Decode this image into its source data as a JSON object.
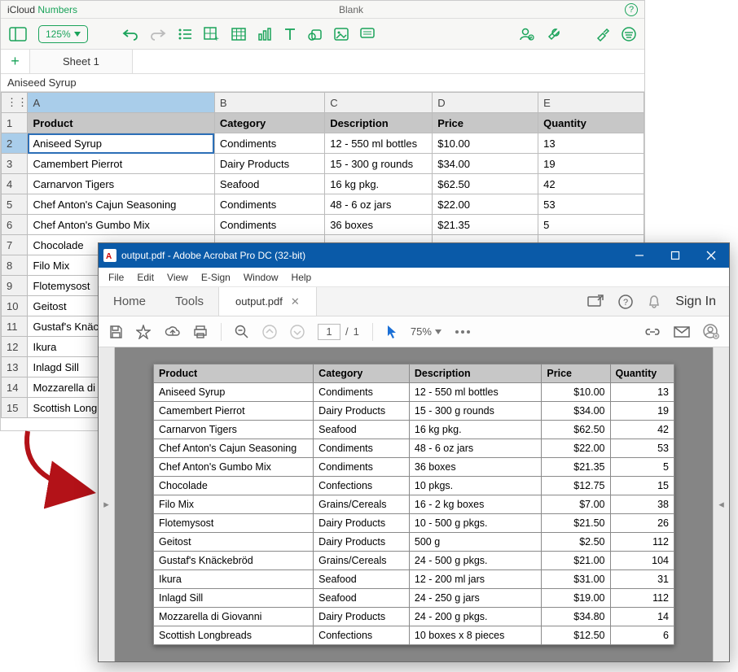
{
  "numbers": {
    "brand_prefix": "iCloud",
    "brand": "Numbers",
    "doc_title": "Blank",
    "zoom": "125%",
    "sheet_tab": "Sheet 1",
    "formula_value": "Aniseed Syrup",
    "columns": [
      "A",
      "B",
      "C",
      "D",
      "E"
    ],
    "headers": [
      "Product",
      "Category",
      "Description",
      "Price",
      "Quantity"
    ],
    "rows": [
      {
        "n": "1",
        "product": "Aniseed Syrup",
        "category": "Condiments",
        "description": "12 - 550 ml bottles",
        "price": "$10.00",
        "quantity": "13"
      },
      {
        "n": "2",
        "product": "Camembert Pierrot",
        "category": "Dairy Products",
        "description": "15 - 300 g rounds",
        "price": "$34.00",
        "quantity": "19"
      },
      {
        "n": "3",
        "product": "Carnarvon Tigers",
        "category": "Seafood",
        "description": "16 kg pkg.",
        "price": "$62.50",
        "quantity": "42"
      },
      {
        "n": "4",
        "product": "Chef Anton's Cajun Seasoning",
        "category": "Condiments",
        "description": "48 - 6 oz jars",
        "price": "$22.00",
        "quantity": "53"
      },
      {
        "n": "5",
        "product": "Chef Anton's Gumbo Mix",
        "category": "Condiments",
        "description": "36 boxes",
        "price": "$21.35",
        "quantity": "5"
      },
      {
        "n": "6",
        "product": "Chocolade",
        "category": "",
        "description": "",
        "price": "",
        "quantity": ""
      },
      {
        "n": "7",
        "product": "Filo Mix",
        "category": "",
        "description": "",
        "price": "",
        "quantity": ""
      },
      {
        "n": "8",
        "product": "Flotemysost",
        "category": "",
        "description": "",
        "price": "",
        "quantity": ""
      },
      {
        "n": "9",
        "product": "Geitost",
        "category": "",
        "description": "",
        "price": "",
        "quantity": ""
      },
      {
        "n": "10",
        "product": "Gustaf's Knäck",
        "category": "",
        "description": "",
        "price": "",
        "quantity": ""
      },
      {
        "n": "11",
        "product": "Ikura",
        "category": "",
        "description": "",
        "price": "",
        "quantity": ""
      },
      {
        "n": "12",
        "product": "Inlagd Sill",
        "category": "",
        "description": "",
        "price": "",
        "quantity": ""
      },
      {
        "n": "13",
        "product": "Mozzarella di G",
        "category": "",
        "description": "",
        "price": "",
        "quantity": ""
      },
      {
        "n": "14",
        "product": "Scottish Longb",
        "category": "",
        "description": "",
        "price": "",
        "quantity": ""
      }
    ]
  },
  "acrobat": {
    "window_title": "output.pdf - Adobe Acrobat Pro DC (32-bit)",
    "menus": [
      "File",
      "Edit",
      "View",
      "E-Sign",
      "Window",
      "Help"
    ],
    "nav_home": "Home",
    "nav_tools": "Tools",
    "doc_tab": "output.pdf",
    "sign_in": "Sign In",
    "page_current": "1",
    "page_sep": "/",
    "page_total": "1",
    "zoom": "75%",
    "headers": [
      "Product",
      "Category",
      "Description",
      "Price",
      "Quantity"
    ],
    "rows": [
      {
        "product": "Aniseed Syrup",
        "category": "Condiments",
        "description": "12 - 550 ml bottles",
        "price": "$10.00",
        "quantity": "13"
      },
      {
        "product": "Camembert Pierrot",
        "category": "Dairy Products",
        "description": "15 - 300 g rounds",
        "price": "$34.00",
        "quantity": "19"
      },
      {
        "product": "Carnarvon Tigers",
        "category": "Seafood",
        "description": "16 kg pkg.",
        "price": "$62.50",
        "quantity": "42"
      },
      {
        "product": "Chef Anton's Cajun Seasoning",
        "category": "Condiments",
        "description": "48 - 6 oz jars",
        "price": "$22.00",
        "quantity": "53"
      },
      {
        "product": "Chef Anton's Gumbo Mix",
        "category": "Condiments",
        "description": "36 boxes",
        "price": "$21.35",
        "quantity": "5"
      },
      {
        "product": "Chocolade",
        "category": "Confections",
        "description": "10 pkgs.",
        "price": "$12.75",
        "quantity": "15"
      },
      {
        "product": "Filo Mix",
        "category": "Grains/Cereals",
        "description": "16 - 2 kg boxes",
        "price": "$7.00",
        "quantity": "38"
      },
      {
        "product": "Flotemysost",
        "category": "Dairy Products",
        "description": "10 - 500 g pkgs.",
        "price": "$21.50",
        "quantity": "26"
      },
      {
        "product": "Geitost",
        "category": "Dairy Products",
        "description": "500 g",
        "price": "$2.50",
        "quantity": "112"
      },
      {
        "product": "Gustaf's Knäckebröd",
        "category": "Grains/Cereals",
        "description": "24 - 500 g pkgs.",
        "price": "$21.00",
        "quantity": "104"
      },
      {
        "product": "Ikura",
        "category": "Seafood",
        "description": "12 - 200 ml jars",
        "price": "$31.00",
        "quantity": "31"
      },
      {
        "product": "Inlagd Sill",
        "category": "Seafood",
        "description": "24 - 250 g  jars",
        "price": "$19.00",
        "quantity": "112"
      },
      {
        "product": "Mozzarella di Giovanni",
        "category": "Dairy Products",
        "description": "24 - 200 g pkgs.",
        "price": "$34.80",
        "quantity": "14"
      },
      {
        "product": "Scottish Longbreads",
        "category": "Confections",
        "description": "10 boxes x 8 pieces",
        "price": "$12.50",
        "quantity": "6"
      }
    ]
  }
}
